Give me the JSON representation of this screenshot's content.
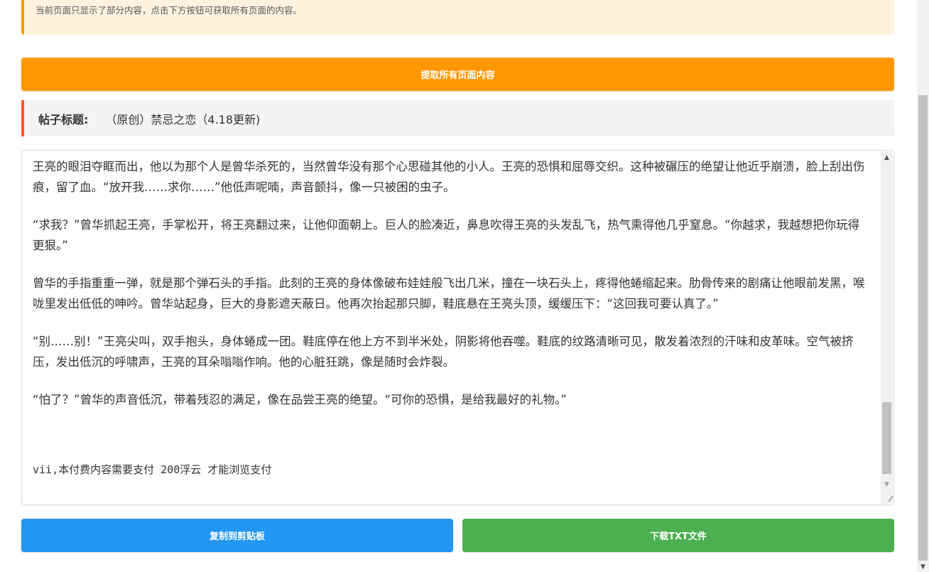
{
  "notice": {
    "text": "当前页面只显示了部分内容，点击下方按钮可获取所有页面的内容。",
    "accent": "#ff9800"
  },
  "extract_button": {
    "label": "提取所有页面内容",
    "color": "#ff9800"
  },
  "post": {
    "title_label": "帖子标题:",
    "title_value": "（原创）禁忌之恋（4.18更新)"
  },
  "content": {
    "paragraphs": [
      "王亮的眼泪夺眶而出，他以为那个人是曾华杀死的，当然曾华没有那个心思碰其他的小人。王亮的恐惧和屈辱交织。这种被碾压的绝望让他近乎崩溃，脸上刮出伤痕，留了血。“放开我……求你……”他低声呢喃，声音颤抖，像一只被困的虫子。",
      "“求我？”曾华抓起王亮，手掌松开，将王亮翻过来，让他仰面朝上。巨人的脸凑近，鼻息吹得王亮的头发乱飞，热气熏得他几乎窒息。“你越求，我越想把你玩得更狠。”",
      "曾华的手指重重一弹，就是那个弹石头的手指。此刻的王亮的身体像破布娃娃般飞出几米，撞在一块石头上，疼得他蜷缩起来。肋骨传来的剧痛让他眼前发黑，喉咙里发出低低的呻吟。曾华站起身，巨大的身影遮天蔽日。他再次抬起那只脚，鞋底悬在王亮头顶，缓缓压下：“这回我可要认真了。”",
      "“别……别！”王亮尖叫，双手抱头，身体蜷成一团。鞋底停在他上方不到半米处，阴影将他吞噬。鞋底的纹路清晰可见，散发着浓烈的汗味和皮革味。空气被挤压，发出低沉的呼啸声，王亮的耳朵嗡嗡作响。他的心脏狂跳，像是随时会炸裂。",
      "“怕了？”曾华的声音低沉，带着残忍的满足，像在品尝王亮的绝望。“可你的恐惧，是给我最好的礼物。”"
    ],
    "payment_note": "vii,本付费内容需要支付 200浮云 才能浏览支付"
  },
  "copy_button": {
    "label": "复制到剪贴板",
    "color": "#2196f3"
  },
  "download_button": {
    "label": "下载TXT文件",
    "color": "#4caf50"
  }
}
